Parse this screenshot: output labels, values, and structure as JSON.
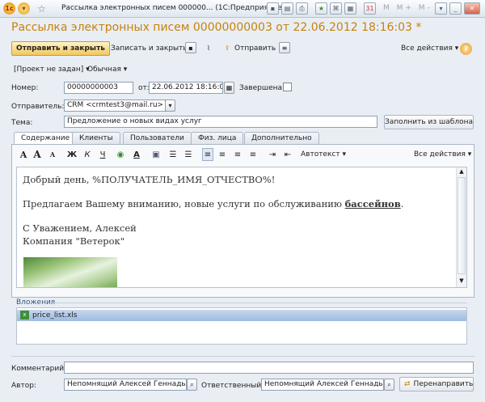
{
  "window": {
    "title": "Рассылка электронных писем 000000... (1С:Предприятие)"
  },
  "document": {
    "title": "Рассылка электронных писем 00000000003 от 22.06.2012 18:16:03 *"
  },
  "toolbar": {
    "send_close": "Отправить и закрыть",
    "save_close": "Записать и закрыть",
    "send": "Отправить",
    "all_actions": "Все действия"
  },
  "subbar": {
    "project": "[Проект не задан]",
    "priority": "Обычная"
  },
  "header": {
    "number_label": "Номер:",
    "number_value": "00000000003",
    "date_label": "от:",
    "date_value": "22.06.2012 18:16:03",
    "completed_label": "Завершена:",
    "sender_label": "Отправитель:",
    "sender_value": "CRM <crmtest3@mail.ru>",
    "subject_label": "Тема:",
    "subject_value": "Предложение о новых видах услуг",
    "fill_template": "Заполнить из шаблона"
  },
  "tabs": [
    {
      "label": "Содержание"
    },
    {
      "label": "Клиенты"
    },
    {
      "label": "Пользователи"
    },
    {
      "label": "Физ. лица"
    },
    {
      "label": "Дополнительно"
    }
  ],
  "format_toolbar": {
    "autotext": "Автотекст",
    "all_actions": "Все действия"
  },
  "editor": {
    "line1": "Добрый день, %ПОЛУЧАТЕЛЬ_ИМЯ_ОТЧЕСТВО%!",
    "line2_pre": "Предлагаем Вашему вниманию, новые услуги по обслуживанию ",
    "line2_bold": "бассейнов",
    "line2_post": ".",
    "line3": "С Уважением, Алексей",
    "line4": "Компания \"Ветерок\""
  },
  "attachments": {
    "label": "Вложения",
    "items": [
      {
        "name": "price_list.xls"
      }
    ]
  },
  "footer": {
    "comment_label": "Комментарий:",
    "comment_value": "",
    "author_label": "Автор:",
    "author_value": "Непомнящий Алексей Геннадьевич",
    "responsible_label": "Ответственный:",
    "responsible_value": "Непомнящий Алексей Геннадьевич",
    "redirect": "Перенаправить"
  },
  "colors": {
    "title": "#c8820a",
    "accent_button": "#f2c75c",
    "selection": "#9fbbe0"
  }
}
